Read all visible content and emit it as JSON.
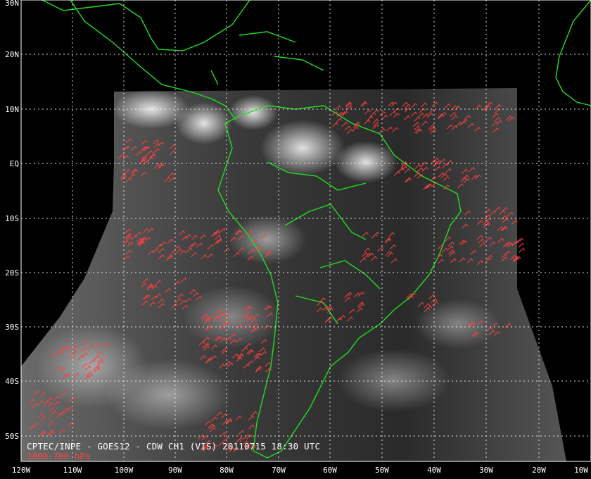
{
  "caption": "CPTEC/INPE - GOES12 - CDW CH1 (VIS) 20110715 18:30 UTC",
  "legend_label": "1000-700 hPa",
  "colors": {
    "background": "#000000",
    "coastline": "#22dd22",
    "wind_barbs": "#ff4040",
    "grid": "#ffffff",
    "label_text": "#ffffff"
  },
  "lat_labels": [
    "30N",
    "20N",
    "10N",
    "EQ",
    "10S",
    "20S",
    "30S",
    "40S",
    "50S"
  ],
  "lon_labels": [
    "120W",
    "110W",
    "100W",
    "90W",
    "80W",
    "70W",
    "60W",
    "50W",
    "40W",
    "30W",
    "20W",
    "10W"
  ],
  "icons": {
    "barbs": "wind-barb-icon"
  }
}
